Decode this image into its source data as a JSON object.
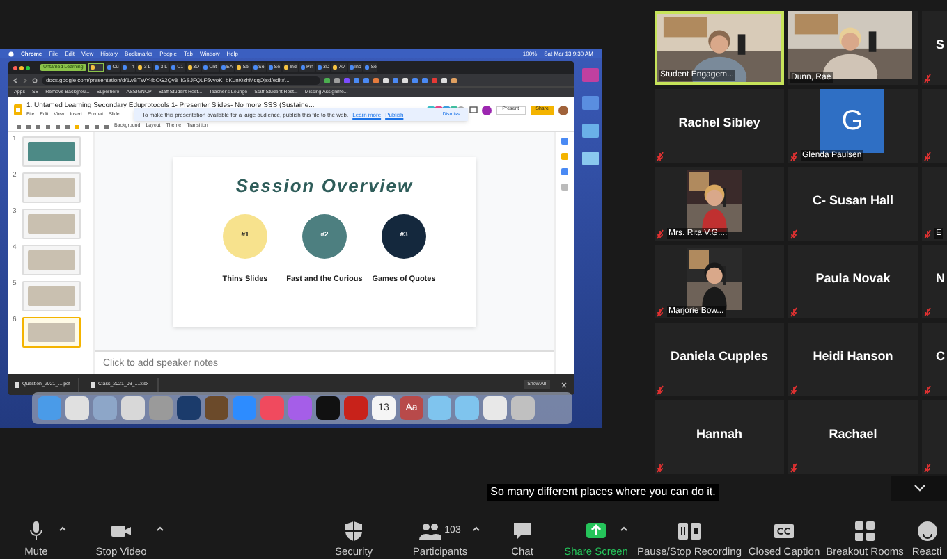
{
  "shared_screen": {
    "mac_menu": {
      "items": [
        "Chrome",
        "File",
        "Edit",
        "View",
        "History",
        "Bookmarks",
        "People",
        "Tab",
        "Window",
        "Help"
      ],
      "battery": "100%",
      "clock": "Sat Mar 13 9:30 AM"
    },
    "browser": {
      "tab_group": "Untamed Learning",
      "tabs": [
        {
          "selected": true
        },
        {
          "label": "Cu",
          "selected": false
        },
        {
          "label": "Th",
          "selected": false
        },
        {
          "label": "3 L",
          "selected": false
        },
        {
          "label": "3 L",
          "selected": false
        },
        {
          "label": "U1",
          "selected": false
        },
        {
          "label": "3D",
          "selected": false
        },
        {
          "label": "Unt",
          "selected": false
        },
        {
          "label": "EA",
          "selected": false
        },
        {
          "label": "Se",
          "selected": false
        },
        {
          "label": "Se",
          "selected": false
        },
        {
          "label": "Se",
          "selected": false
        },
        {
          "label": "Ind",
          "selected": false
        },
        {
          "label": "Pin",
          "selected": false
        },
        {
          "label": "3D",
          "selected": false
        },
        {
          "label": "Av",
          "selected": false
        },
        {
          "label": "Inc",
          "selected": false
        },
        {
          "label": "Se",
          "selected": false
        }
      ],
      "url": "docs.google.com/presentation/d/1wBTWY-fbOG2Qv8_iGSJFQLF5vyoK_bKunt0zhMcqOjsd/edit#...",
      "bookmarks": [
        "Apps",
        "SS",
        "Remove Backgrou...",
        "Superhero",
        "ASSIGNCP",
        "Staff Student Rost...",
        "Teacher's Lounge",
        "Staff Student Rost...",
        "Missing Assignme..."
      ],
      "doc": {
        "title": "1. Untamed Learning Secondary Eduprotocols 1- Presenter Slides- No more SSS (Sustaine...",
        "menu": [
          "File",
          "Edit",
          "View",
          "Insert",
          "Format",
          "Slide"
        ],
        "banner": {
          "text": "To make this presentation available for a large audience, publish this file to the web.",
          "links": [
            "Learn more",
            "Publish"
          ],
          "dismiss": "Dismiss"
        },
        "present": "Present",
        "share": "Share",
        "toolbar": [
          "Background",
          "Layout",
          "Theme",
          "Transition"
        ],
        "thumbnails": [
          {
            "number": "1",
            "selected": false
          },
          {
            "number": "2",
            "selected": false
          },
          {
            "number": "3",
            "selected": false
          },
          {
            "number": "4",
            "selected": false
          },
          {
            "number": "5",
            "selected": false
          },
          {
            "number": "6",
            "selected": true
          }
        ],
        "slide": {
          "title": "Session Overview",
          "items": [
            {
              "number": "#1",
              "label": "Thins Slides",
              "color": "#f7e28d"
            },
            {
              "number": "#2",
              "label": "Fast and the Curious",
              "color": "#4d7f80"
            },
            {
              "number": "#3",
              "label": "Games of Quotes",
              "color": "#14283d"
            }
          ]
        },
        "speaker_notes": "Click to add speaker notes"
      },
      "downloads": [
        "Question_2021_....pdf",
        "Class_2021_03_....xlsx"
      ],
      "show_all": "Show All"
    },
    "dock": [
      {
        "color": "#4a9be8"
      },
      {
        "color": "#e0e0e0"
      },
      {
        "color": "#8da6c8"
      },
      {
        "color": "#d8d8d8"
      },
      {
        "color": "#9a9a9a"
      },
      {
        "color": "#1b3b6b"
      },
      {
        "color": "#6b4a2a"
      },
      {
        "color": "#2d8cff"
      },
      {
        "color": "#f04a5e"
      },
      {
        "color": "#a55ee8"
      },
      {
        "color": "#111111"
      },
      {
        "color": "#c8221a"
      },
      {
        "color": "#f5f5f5",
        "text": "13"
      },
      {
        "color": "#b84a4a",
        "text": "Aa"
      },
      {
        "color": "#7fc4ee"
      },
      {
        "color": "#7fc4ee"
      },
      {
        "color": "#e8e8e8"
      },
      {
        "color": "#c0c0c0"
      }
    ]
  },
  "gallery": [
    {
      "kind": "video",
      "label": "Student Engagem...",
      "muted": false,
      "speaking": true
    },
    {
      "kind": "video",
      "label": "Dunn, Rae",
      "muted": false,
      "speaking": false
    },
    {
      "kind": "blank",
      "name": "S",
      "muted": true,
      "speaking": false,
      "partial": true
    },
    {
      "kind": "blank",
      "name": "Rachel Sibley",
      "muted": true,
      "speaking": false
    },
    {
      "kind": "avatar",
      "initial": "G",
      "label": "Glenda Paulsen",
      "muted": true,
      "speaking": false
    },
    {
      "kind": "blank",
      "muted": true,
      "speaking": false,
      "partial": true
    },
    {
      "kind": "thumb",
      "label": "Mrs. Rita V.G....",
      "muted": true,
      "speaking": false
    },
    {
      "kind": "blank",
      "name": "C- Susan Hall",
      "muted": true,
      "speaking": false
    },
    {
      "kind": "blank",
      "label": "E",
      "muted": true,
      "speaking": false,
      "partial": true
    },
    {
      "kind": "thumb",
      "label": "Marjorie Bow...",
      "muted": true,
      "speaking": false
    },
    {
      "kind": "blank",
      "name": "Paula Novak",
      "muted": true,
      "speaking": false
    },
    {
      "kind": "blank",
      "name": "N",
      "muted": true,
      "speaking": false,
      "partial": true
    },
    {
      "kind": "blank",
      "name": "Daniela Cupples",
      "muted": true,
      "speaking": false
    },
    {
      "kind": "blank",
      "name": "Heidi Hanson",
      "muted": true,
      "speaking": false
    },
    {
      "kind": "blank",
      "name": "C",
      "muted": true,
      "speaking": false,
      "partial": true
    },
    {
      "kind": "blank",
      "name": "Hannah",
      "muted": true,
      "speaking": false
    },
    {
      "kind": "blank",
      "name": "Rachael",
      "muted": true,
      "speaking": false
    },
    {
      "kind": "blank",
      "muted": true,
      "speaking": false,
      "partial": true
    }
  ],
  "caption": "So many different places where you can do it.",
  "toolbar": [
    {
      "kind": "mic",
      "label": "Mute",
      "menu": true
    },
    {
      "kind": "camera",
      "label": "Stop Video",
      "menu": true
    },
    {
      "kind": "shield",
      "label": "Security",
      "menu": false
    },
    {
      "kind": "people",
      "label": "Participants",
      "count": "103",
      "menu": true
    },
    {
      "kind": "chat",
      "label": "Chat",
      "menu": false
    },
    {
      "kind": "share",
      "label": "Share Screen",
      "menu": true
    },
    {
      "kind": "record",
      "label": "Pause/Stop Recording",
      "menu": false
    },
    {
      "kind": "cc",
      "label": "Closed Caption",
      "menu": false
    },
    {
      "kind": "rooms",
      "label": "Breakout Rooms",
      "menu": false
    },
    {
      "kind": "reactions",
      "label": "Reacti",
      "menu": false
    }
  ]
}
